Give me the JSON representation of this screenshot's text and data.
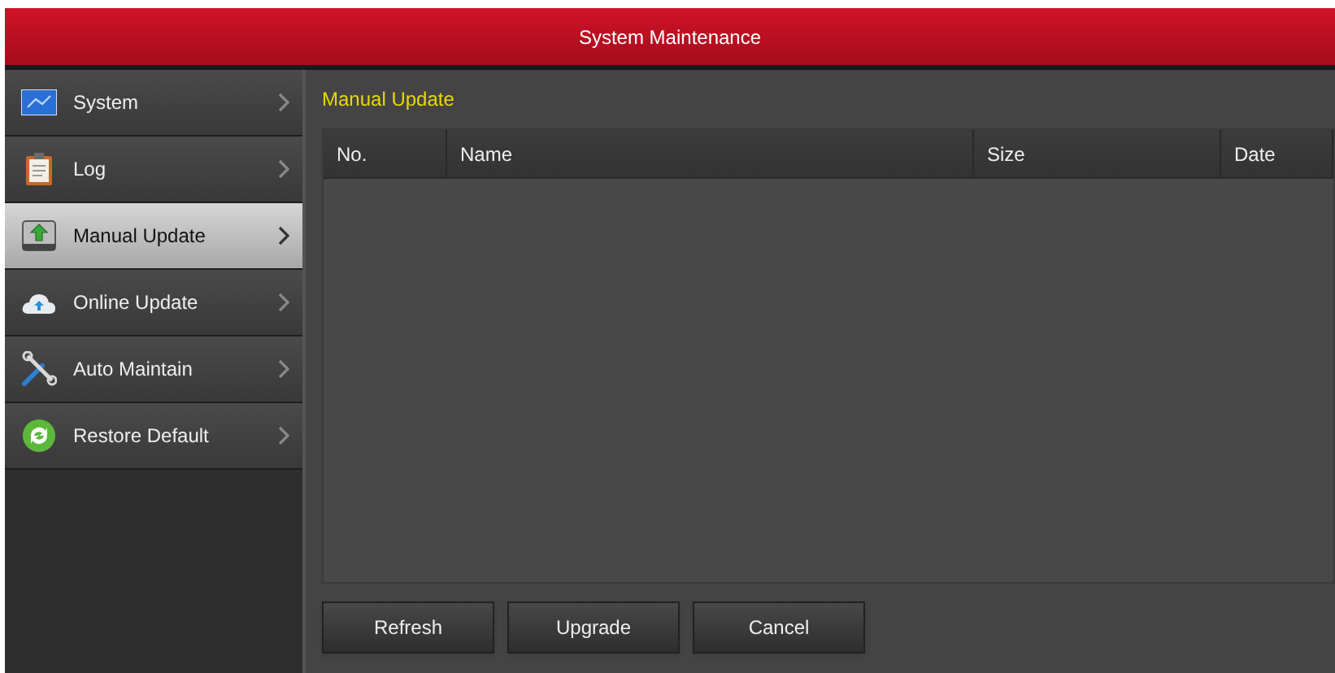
{
  "window": {
    "title": "System Maintenance"
  },
  "sidebar": {
    "items": [
      {
        "label": "System",
        "kind": "monitor",
        "selected": false
      },
      {
        "label": "Log",
        "kind": "clipboard",
        "selected": false
      },
      {
        "label": "Manual Update",
        "kind": "upload",
        "selected": true
      },
      {
        "label": "Online Update",
        "kind": "cloud",
        "selected": false
      },
      {
        "label": "Auto Maintain",
        "kind": "tools",
        "selected": false
      },
      {
        "label": "Restore Default",
        "kind": "refresh",
        "selected": false
      }
    ]
  },
  "panel": {
    "title": "Manual Update",
    "table": {
      "columns": [
        "No.",
        "Name",
        "Size",
        "Date"
      ]
    },
    "buttons": [
      "Refresh",
      "Upgrade",
      "Cancel"
    ]
  }
}
